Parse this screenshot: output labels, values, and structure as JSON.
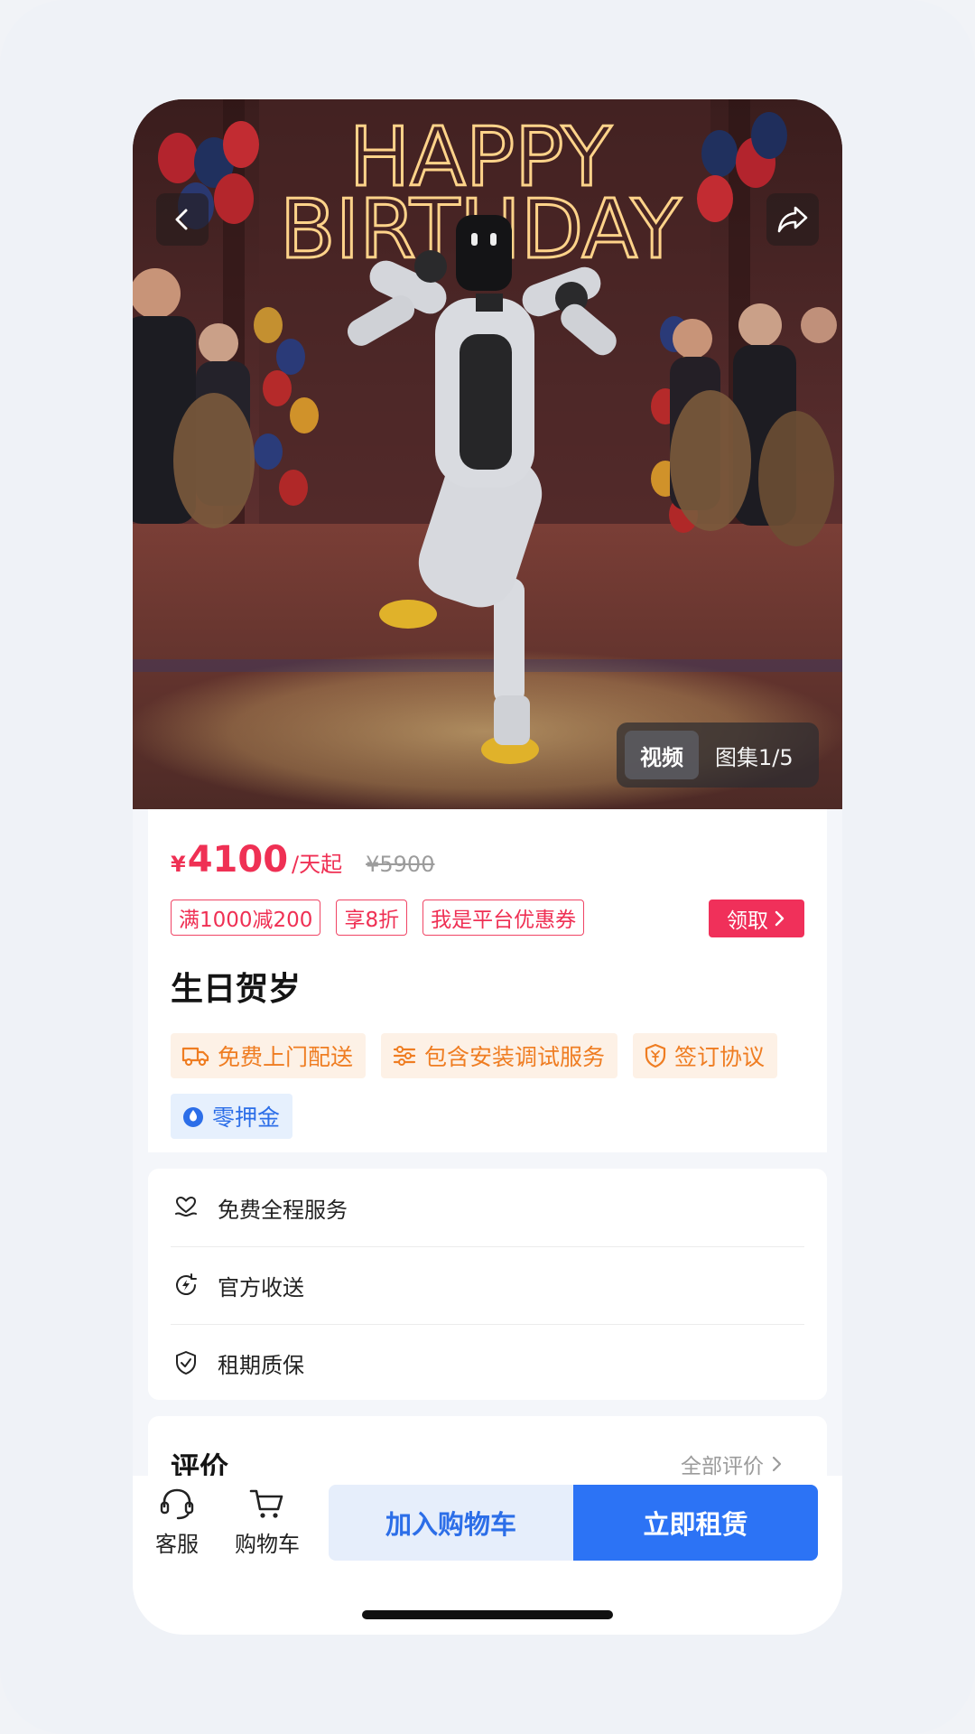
{
  "hero": {
    "neon_line1": "HAPPY",
    "neon_line2": "BIRTHDAY",
    "media_tabs": {
      "video": "视频",
      "gallery": "图集1/5"
    }
  },
  "price": {
    "currency": "¥",
    "amount": "4100",
    "unit": "/天起",
    "original": "¥5900"
  },
  "coupons": [
    "满1000减200",
    "享8折",
    "我是平台优惠券"
  ],
  "claim_button": "领取",
  "product_title": "生日贺岁",
  "features": {
    "delivery": "免费上门配送",
    "install": "包含安装调试服务",
    "agreement": "签订协议",
    "deposit": "零押金"
  },
  "services": [
    "免费全程服务",
    "官方收送",
    "租期质保"
  ],
  "review": {
    "title": "评价",
    "all_link": "全部评价"
  },
  "bottom_bar": {
    "customer_service": "客服",
    "cart": "购物车",
    "add_to_cart": "加入购物车",
    "rent_now": "立即租赁"
  },
  "colors": {
    "price_red": "#ef3054",
    "primary_blue": "#2c73f5",
    "feature_orange": "#ef7d22",
    "feature_blue": "#2c6ee8"
  }
}
